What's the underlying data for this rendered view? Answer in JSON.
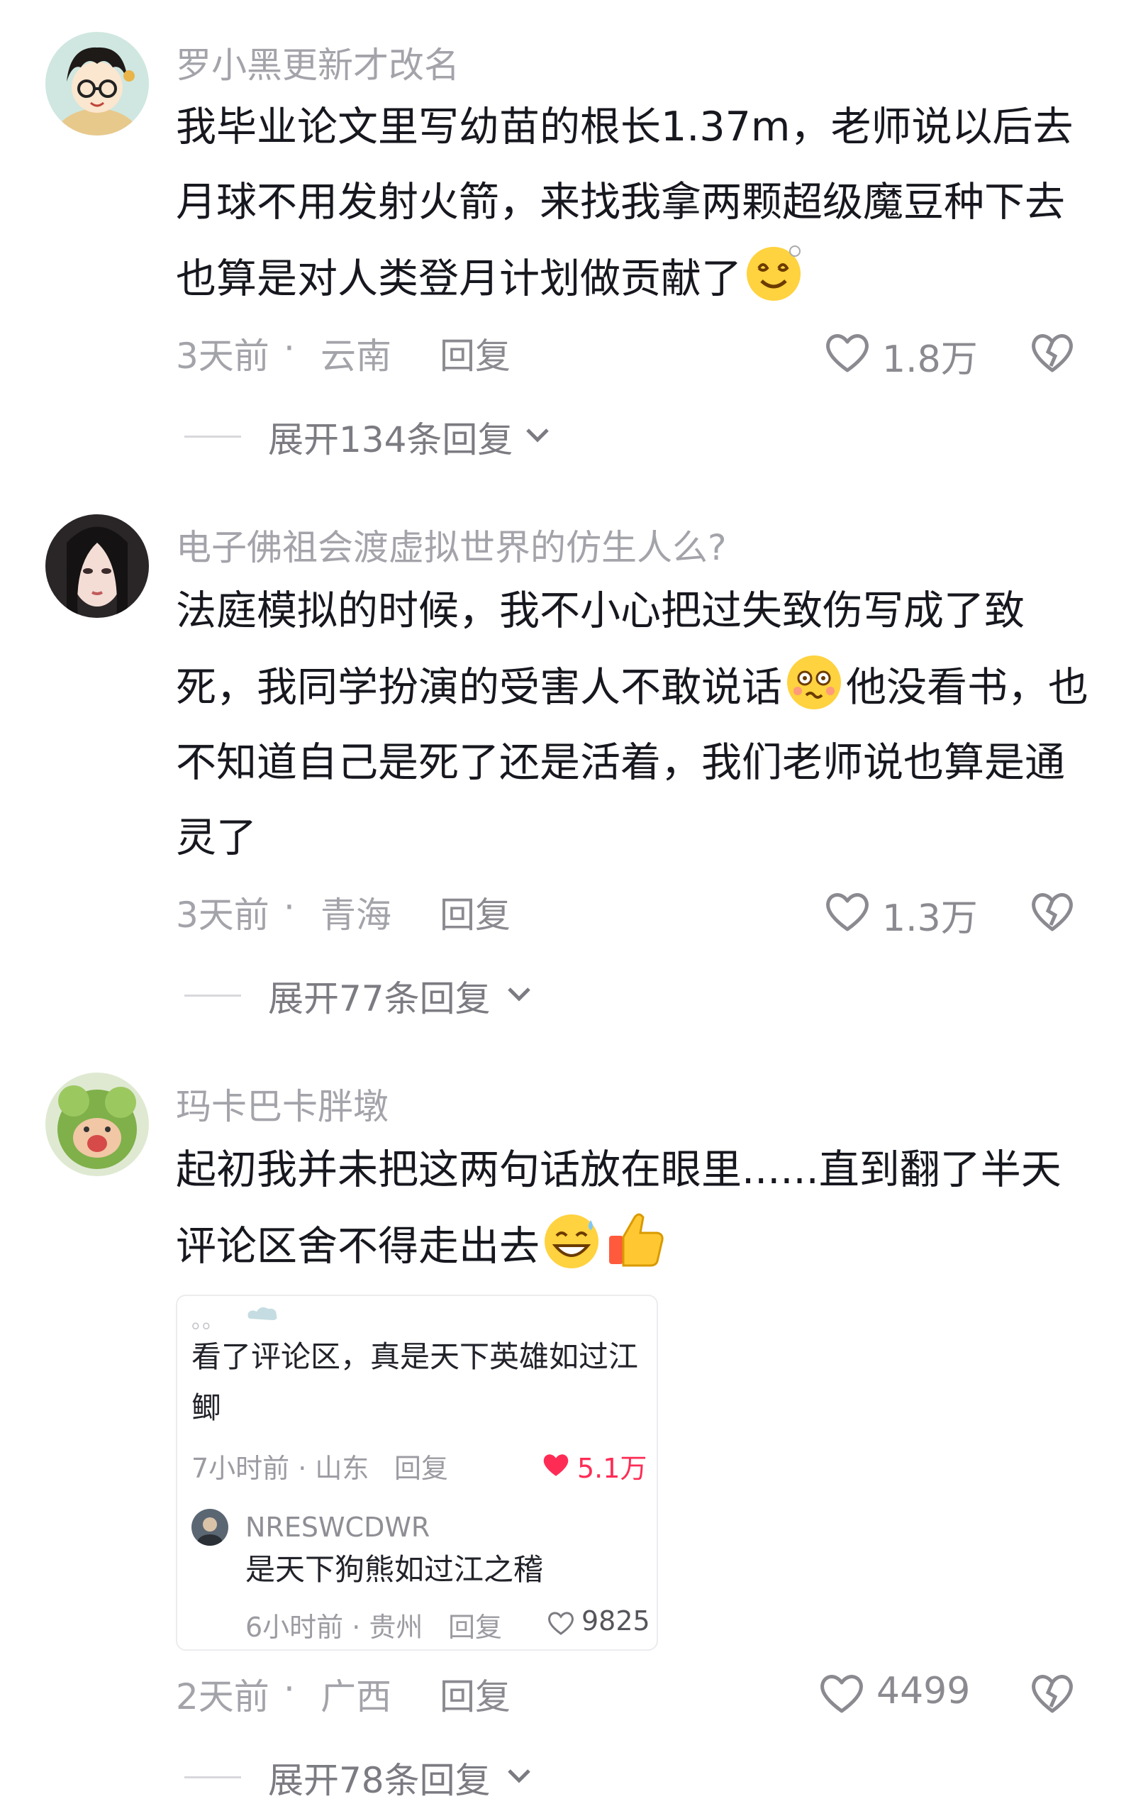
{
  "comments": [
    {
      "username": "罗小黑更新才改名",
      "text": "我毕业论文里写幼苗的根长1.37m，老师说以后去月球不用发射火箭，来找我拿两颗超级魔豆种下去也算是对人类登月计划做贡献了",
      "emoji": "dizzy-smile-emoji",
      "time": "3天前",
      "sep": "·",
      "location": "云南",
      "reply_label": "回复",
      "likes": "1.8万",
      "expand_label": "展开134条回复"
    },
    {
      "username": "电子佛祖会渡虚拟世界的仿生人么?",
      "text_before": "法庭模拟的时候，我不小心把过失致伤写成了致死，我同学扮演的受害人不敢说话",
      "text_after": "他没看书，也不知道自己是死了还是活着，我们老师说也算是通灵了",
      "emoji": "confused-face-emoji",
      "time": "3天前",
      "sep": "·",
      "location": "青海",
      "reply_label": "回复",
      "likes": "1.3万",
      "expand_label": "展开77条回复"
    },
    {
      "username": "玛卡巴卡胖墩",
      "text": "起初我并未把这两句话放在眼里......直到翻了半天评论区舍不得走出去",
      "emojis": [
        "grin-sweat-emoji",
        "thumbs-up-emoji"
      ],
      "time": "2天前",
      "sep": "·",
      "location": "广西",
      "reply_label": "回复",
      "likes": "4499",
      "expand_label": "展开78条回复"
    }
  ],
  "quote_card": {
    "header_dots": "。。",
    "text": "看了评论区，真是天下英雄如过江鲫",
    "meta_time": "7小时前 · 山东",
    "reply_label": "回复",
    "likes": "5.1万",
    "like_color": "#fe2c55",
    "sub_reply": {
      "username": "NRESWCDWR",
      "text": "是天下狗熊如过江之稽",
      "meta_time": "6小时前 · 贵州",
      "reply_label": "回复",
      "likes": "9825"
    }
  }
}
